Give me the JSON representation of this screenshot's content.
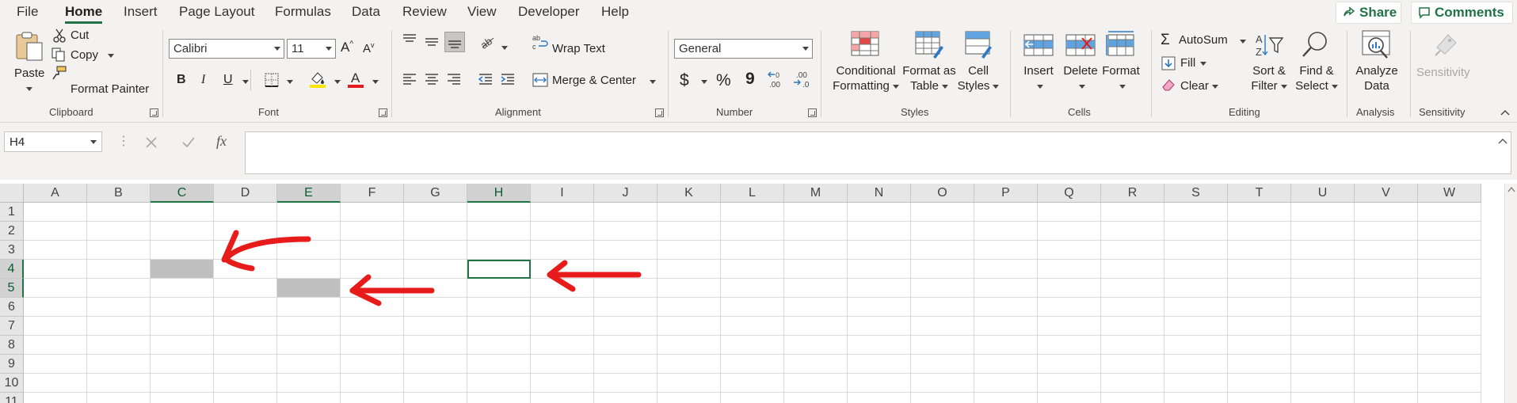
{
  "menu": {
    "tabs": [
      "File",
      "Home",
      "Insert",
      "Page Layout",
      "Formulas",
      "Data",
      "Review",
      "View",
      "Developer",
      "Help"
    ],
    "active_tab": "Home",
    "share_label": "Share",
    "comments_label": "Comments"
  },
  "ribbon": {
    "clipboard": {
      "paste": "Paste",
      "cut": "Cut",
      "copy": "Copy",
      "format_painter": "Format Painter",
      "label": "Clipboard"
    },
    "font": {
      "name": "Calibri",
      "size": "11",
      "label": "Font",
      "bold": "B",
      "italic": "I",
      "underline": "U"
    },
    "alignment": {
      "wrap_text": "Wrap Text",
      "merge_center": "Merge & Center",
      "label": "Alignment"
    },
    "number": {
      "format": "General",
      "label": "Number",
      "currency": "$",
      "percent": "%",
      "comma": "9"
    },
    "styles": {
      "conditional": [
        "Conditional",
        "Formatting"
      ],
      "format_table": [
        "Format as",
        "Table"
      ],
      "cell_styles": [
        "Cell",
        "Styles"
      ],
      "label": "Styles"
    },
    "cells": {
      "insert": "Insert",
      "delete": "Delete",
      "format": "Format",
      "label": "Cells"
    },
    "editing": {
      "autosum": "AutoSum",
      "fill": "Fill",
      "clear": "Clear",
      "sort_filter": [
        "Sort &",
        "Filter"
      ],
      "find_select": [
        "Find &",
        "Select"
      ],
      "label": "Editing"
    },
    "analysis": {
      "analyze": [
        "Analyze",
        "Data"
      ],
      "label": "Analysis"
    },
    "sensitivity": {
      "button": "Sensitivity",
      "label": "Sensitivity"
    }
  },
  "formula_bar": {
    "name_box": "H4",
    "formula": "",
    "fx": "fx"
  },
  "grid": {
    "columns": [
      "A",
      "B",
      "C",
      "D",
      "E",
      "F",
      "G",
      "H",
      "I",
      "J",
      "K",
      "L",
      "M",
      "N",
      "O",
      "P",
      "Q",
      "R",
      "S",
      "T",
      "U",
      "V",
      "W"
    ],
    "rows": [
      "1",
      "2",
      "3",
      "4",
      "5",
      "6",
      "7",
      "8",
      "9",
      "10",
      "11"
    ],
    "selected_columns": [
      "C",
      "E",
      "H"
    ],
    "selected_rows": [
      "4",
      "5"
    ],
    "active_cell": "H4",
    "shaded_cells": [
      "C4",
      "E5"
    ],
    "annotation_color": "#e81b1b",
    "accent_color": "#217346"
  }
}
